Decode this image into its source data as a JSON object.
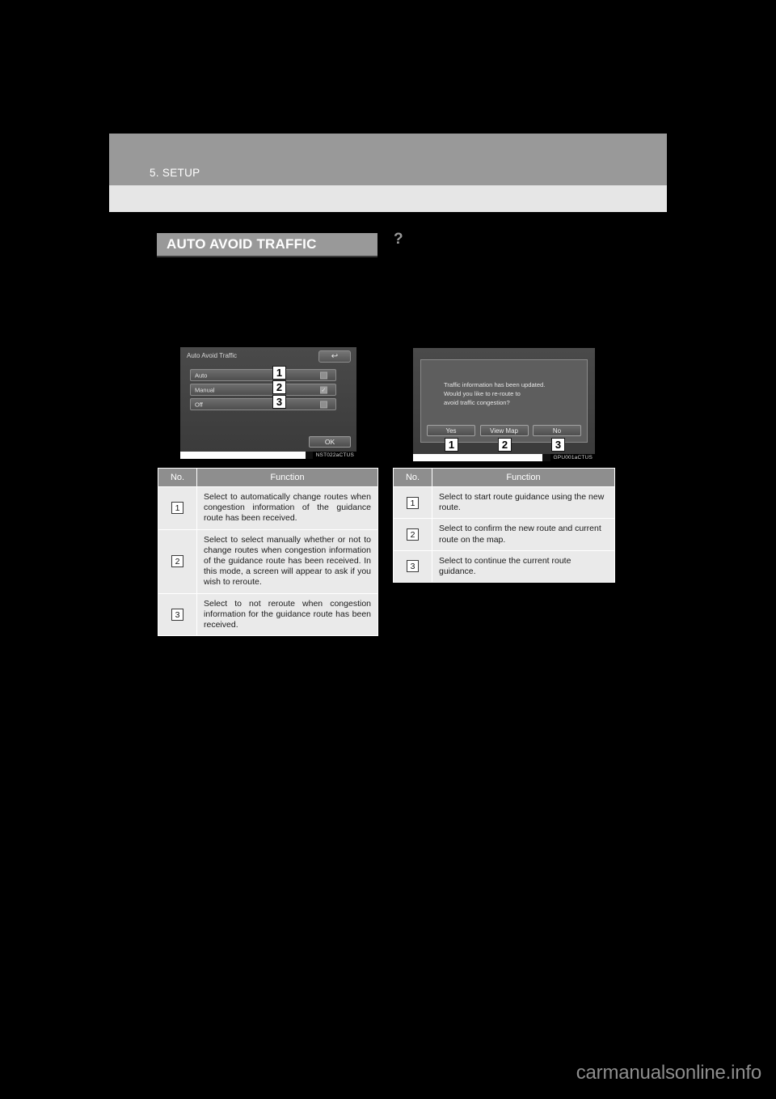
{
  "header": {
    "chapter": "5. SETUP"
  },
  "section": {
    "title": "AUTO AVOID TRAFFIC",
    "icon": "?"
  },
  "screenshots": {
    "left": {
      "caption": "NST022aCTUS",
      "title": "Auto Avoid Traffic",
      "back_icon": "↩",
      "rows": [
        {
          "label": "Auto",
          "checked": ""
        },
        {
          "label": "Manual",
          "checked": "✓"
        },
        {
          "label": "Off",
          "checked": ""
        }
      ],
      "ok_label": "OK",
      "badges": [
        "1",
        "2",
        "3"
      ]
    },
    "right": {
      "caption": "GPU001aCTUS",
      "message_line1": "Traffic information has been updated.",
      "message_line2": "Would you like to re-route to",
      "message_line3": "avoid traffic congestion?",
      "buttons": [
        "Yes",
        "View Map",
        "No"
      ],
      "badges": [
        "1",
        "2",
        "3"
      ]
    }
  },
  "tables": {
    "left": {
      "headers": {
        "no": "No.",
        "function": "Function"
      },
      "rows": [
        {
          "no": "1",
          "function": "Select to automatically change routes when congestion information of the guidance route has been received."
        },
        {
          "no": "2",
          "function": "Select to select manually whether or not to change routes when congestion information of the guidance route has been received. In this mode, a screen will appear to ask if you wish to reroute."
        },
        {
          "no": "3",
          "function": "Select to not reroute when congestion information for the guidance route has been received."
        }
      ]
    },
    "right": {
      "headers": {
        "no": "No.",
        "function": "Function"
      },
      "rows": [
        {
          "no": "1",
          "function": "Select to start route guidance using the new route."
        },
        {
          "no": "2",
          "function": "Select to confirm the new route and current route on the map."
        },
        {
          "no": "3",
          "function": "Select to continue the current route guidance."
        }
      ]
    }
  },
  "watermark": "carmanualsonline.info"
}
